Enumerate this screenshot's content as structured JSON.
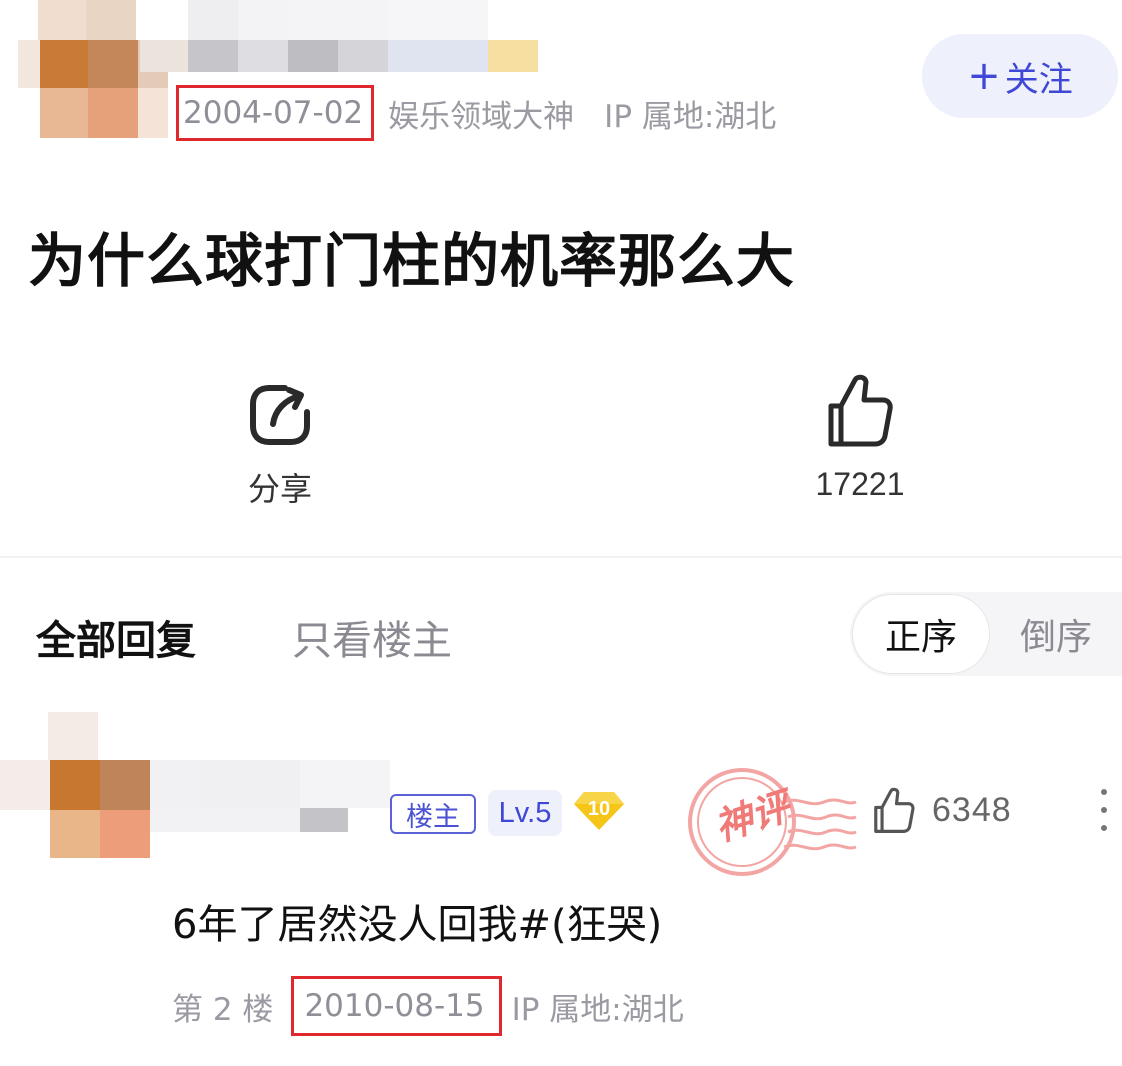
{
  "post": {
    "date": "2004-07-02",
    "author_title": "娱乐领域大神",
    "ip_location": "IP 属地:湖北",
    "follow_label": "关注",
    "title": "为什么球打门柱的机率那么大",
    "share_label": "分享",
    "like_count": "17221"
  },
  "replies_header": {
    "tab_all": "全部回复",
    "tab_op_only": "只看楼主",
    "sort_asc": "正序",
    "sort_desc": "倒序"
  },
  "reply": {
    "op_badge": "楼主",
    "level": "Lv.5",
    "gem_level": "10",
    "stamp_text": "神评",
    "like_count": "6348",
    "content": "6年了居然没人回我#(狂哭)",
    "floor": "第 2 楼",
    "date": "2010-08-15",
    "ip_location": "IP 属地:湖北"
  },
  "colors": {
    "accent": "#3e47d6",
    "highlight_box": "#e0282f",
    "muted_text": "#9a9aa2",
    "stamp": "#f07a78",
    "gem": "#f5c518"
  },
  "icons": [
    "share-icon",
    "thumbs-up-icon",
    "more-icon",
    "plus-icon"
  ]
}
